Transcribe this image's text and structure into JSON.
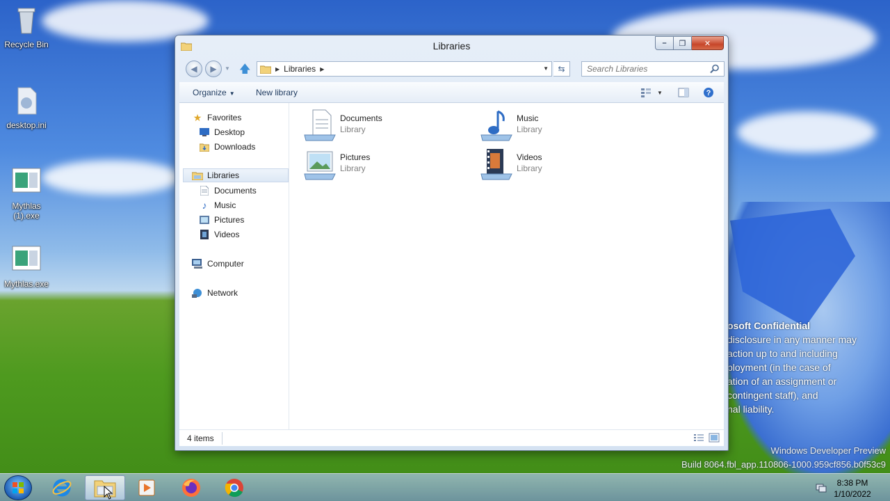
{
  "desktop": {
    "icons": [
      {
        "label": "Recycle Bin"
      },
      {
        "label": "desktop.ini"
      },
      {
        "label": "Mythlas (1).exe"
      },
      {
        "label": "Mythlas.exe"
      }
    ],
    "confidential": {
      "heading": "osoft Confidential",
      "lines": [
        "disclosure in any manner may",
        "action up to and including",
        "ployment (in the case of",
        "ation of an assignment or",
        "contingent staff), and",
        "nal liability."
      ]
    },
    "watermark": {
      "line1": "Windows Developer Preview",
      "line2": "Build 8064.fbl_app.110806-1000.959cf856.b0f53c9"
    }
  },
  "window": {
    "title": "Libraries",
    "address": {
      "crumb": "Libraries"
    },
    "search": {
      "placeholder": "Search Libraries"
    },
    "commands": {
      "organize": "Organize",
      "new_library": "New library"
    },
    "nav": {
      "favorites": "Favorites",
      "desktop": "Desktop",
      "downloads": "Downloads",
      "libraries": "Libraries",
      "documents": "Documents",
      "music": "Music",
      "pictures": "Pictures",
      "videos": "Videos",
      "computer": "Computer",
      "network": "Network"
    },
    "tiles": [
      {
        "name": "Documents",
        "kind": "Library"
      },
      {
        "name": "Music",
        "kind": "Library"
      },
      {
        "name": "Pictures",
        "kind": "Library"
      },
      {
        "name": "Videos",
        "kind": "Library"
      }
    ],
    "status": {
      "count": "4 items"
    }
  },
  "taskbar": {
    "clock": {
      "time": "8:38 PM",
      "date": "1/10/2022"
    }
  },
  "colors": {
    "accent": "#3d8fd6",
    "title_text": "#1e1e1e",
    "library_text": "#808080"
  }
}
